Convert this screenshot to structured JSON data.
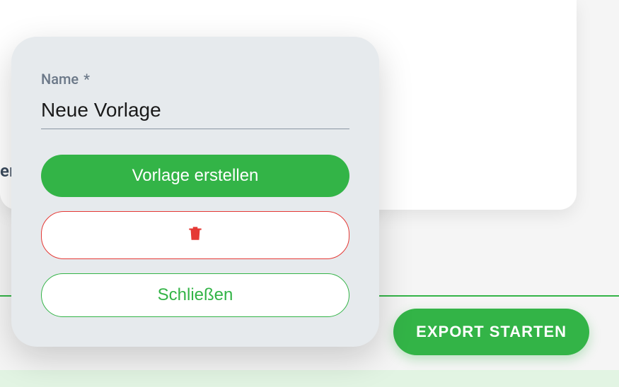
{
  "background": {
    "fragment_text": "eı"
  },
  "modal": {
    "name_label": "Name",
    "required_marker": "*",
    "name_value": "Neue Vorlage",
    "create_button": "Vorlage erstellen",
    "close_button": "Schließen"
  },
  "footer": {
    "export_button": "EXPORT STARTEN"
  }
}
